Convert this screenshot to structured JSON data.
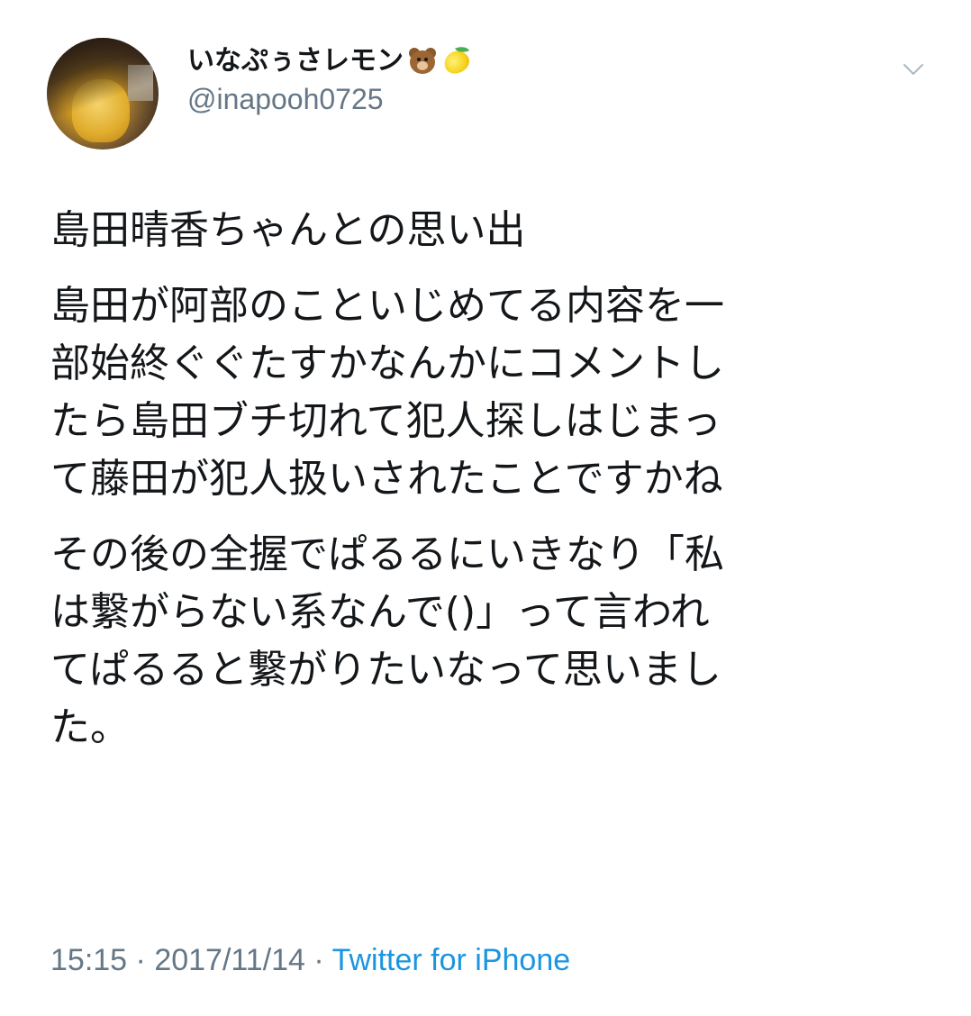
{
  "user": {
    "display_name": "いなぷぅさレモン",
    "emojis": [
      "bear-icon",
      "lemon-icon"
    ],
    "handle": "@inapooh0725"
  },
  "tweet": {
    "paragraphs": [
      "島田晴香ちゃんとの思い出",
      "島田が阿部のこといじめてる内容を一\n部始終ぐぐたすかなんかにコメントし\nたら島田ブチ切れて犯人探しはじまっ\nて藤田が犯人扱いされたことですかね",
      "その後の全握でぱるるにいきなり「私\nは繋がらない系なんで()」って言われ\nてぱるると繋がりたいなって思いまし\nた。"
    ],
    "time": "15:15",
    "separator": " · ",
    "date": "2017/11/14",
    "source": "Twitter for iPhone"
  },
  "colors": {
    "text": "#14171a",
    "secondary": "#657786",
    "link": "#1b95e0"
  }
}
